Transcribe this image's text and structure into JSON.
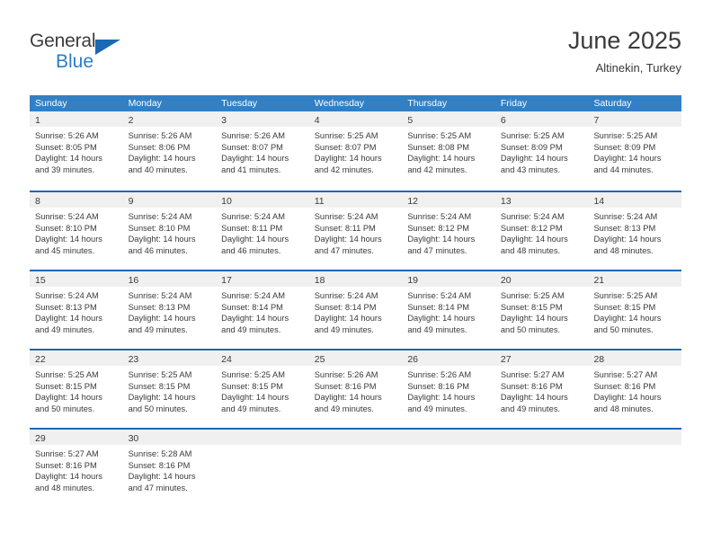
{
  "logo": {
    "word_one": "General",
    "word_two": "Blue",
    "triangle_color": "#1b68b3",
    "blue_text_color": "#2a7ec8"
  },
  "header": {
    "title": "June 2025",
    "location": "Altinekin, Turkey"
  },
  "theme": {
    "header_bar_color": "#3280c3",
    "row_divider_color": "#1b68b3",
    "daynum_strip_color": "#f0f0f0",
    "text_color": "#3a3a3a"
  },
  "weekdays": [
    "Sunday",
    "Monday",
    "Tuesday",
    "Wednesday",
    "Thursday",
    "Friday",
    "Saturday"
  ],
  "weeks": [
    [
      {
        "day": "1",
        "sunrise": "Sunrise: 5:26 AM",
        "sunset": "Sunset: 8:05 PM",
        "daylight": "Daylight: 14 hours and 39 minutes."
      },
      {
        "day": "2",
        "sunrise": "Sunrise: 5:26 AM",
        "sunset": "Sunset: 8:06 PM",
        "daylight": "Daylight: 14 hours and 40 minutes."
      },
      {
        "day": "3",
        "sunrise": "Sunrise: 5:26 AM",
        "sunset": "Sunset: 8:07 PM",
        "daylight": "Daylight: 14 hours and 41 minutes."
      },
      {
        "day": "4",
        "sunrise": "Sunrise: 5:25 AM",
        "sunset": "Sunset: 8:07 PM",
        "daylight": "Daylight: 14 hours and 42 minutes."
      },
      {
        "day": "5",
        "sunrise": "Sunrise: 5:25 AM",
        "sunset": "Sunset: 8:08 PM",
        "daylight": "Daylight: 14 hours and 42 minutes."
      },
      {
        "day": "6",
        "sunrise": "Sunrise: 5:25 AM",
        "sunset": "Sunset: 8:09 PM",
        "daylight": "Daylight: 14 hours and 43 minutes."
      },
      {
        "day": "7",
        "sunrise": "Sunrise: 5:25 AM",
        "sunset": "Sunset: 8:09 PM",
        "daylight": "Daylight: 14 hours and 44 minutes."
      }
    ],
    [
      {
        "day": "8",
        "sunrise": "Sunrise: 5:24 AM",
        "sunset": "Sunset: 8:10 PM",
        "daylight": "Daylight: 14 hours and 45 minutes."
      },
      {
        "day": "9",
        "sunrise": "Sunrise: 5:24 AM",
        "sunset": "Sunset: 8:10 PM",
        "daylight": "Daylight: 14 hours and 46 minutes."
      },
      {
        "day": "10",
        "sunrise": "Sunrise: 5:24 AM",
        "sunset": "Sunset: 8:11 PM",
        "daylight": "Daylight: 14 hours and 46 minutes."
      },
      {
        "day": "11",
        "sunrise": "Sunrise: 5:24 AM",
        "sunset": "Sunset: 8:11 PM",
        "daylight": "Daylight: 14 hours and 47 minutes."
      },
      {
        "day": "12",
        "sunrise": "Sunrise: 5:24 AM",
        "sunset": "Sunset: 8:12 PM",
        "daylight": "Daylight: 14 hours and 47 minutes."
      },
      {
        "day": "13",
        "sunrise": "Sunrise: 5:24 AM",
        "sunset": "Sunset: 8:12 PM",
        "daylight": "Daylight: 14 hours and 48 minutes."
      },
      {
        "day": "14",
        "sunrise": "Sunrise: 5:24 AM",
        "sunset": "Sunset: 8:13 PM",
        "daylight": "Daylight: 14 hours and 48 minutes."
      }
    ],
    [
      {
        "day": "15",
        "sunrise": "Sunrise: 5:24 AM",
        "sunset": "Sunset: 8:13 PM",
        "daylight": "Daylight: 14 hours and 49 minutes."
      },
      {
        "day": "16",
        "sunrise": "Sunrise: 5:24 AM",
        "sunset": "Sunset: 8:13 PM",
        "daylight": "Daylight: 14 hours and 49 minutes."
      },
      {
        "day": "17",
        "sunrise": "Sunrise: 5:24 AM",
        "sunset": "Sunset: 8:14 PM",
        "daylight": "Daylight: 14 hours and 49 minutes."
      },
      {
        "day": "18",
        "sunrise": "Sunrise: 5:24 AM",
        "sunset": "Sunset: 8:14 PM",
        "daylight": "Daylight: 14 hours and 49 minutes."
      },
      {
        "day": "19",
        "sunrise": "Sunrise: 5:24 AM",
        "sunset": "Sunset: 8:14 PM",
        "daylight": "Daylight: 14 hours and 49 minutes."
      },
      {
        "day": "20",
        "sunrise": "Sunrise: 5:25 AM",
        "sunset": "Sunset: 8:15 PM",
        "daylight": "Daylight: 14 hours and 50 minutes."
      },
      {
        "day": "21",
        "sunrise": "Sunrise: 5:25 AM",
        "sunset": "Sunset: 8:15 PM",
        "daylight": "Daylight: 14 hours and 50 minutes."
      }
    ],
    [
      {
        "day": "22",
        "sunrise": "Sunrise: 5:25 AM",
        "sunset": "Sunset: 8:15 PM",
        "daylight": "Daylight: 14 hours and 50 minutes."
      },
      {
        "day": "23",
        "sunrise": "Sunrise: 5:25 AM",
        "sunset": "Sunset: 8:15 PM",
        "daylight": "Daylight: 14 hours and 50 minutes."
      },
      {
        "day": "24",
        "sunrise": "Sunrise: 5:25 AM",
        "sunset": "Sunset: 8:15 PM",
        "daylight": "Daylight: 14 hours and 49 minutes."
      },
      {
        "day": "25",
        "sunrise": "Sunrise: 5:26 AM",
        "sunset": "Sunset: 8:16 PM",
        "daylight": "Daylight: 14 hours and 49 minutes."
      },
      {
        "day": "26",
        "sunrise": "Sunrise: 5:26 AM",
        "sunset": "Sunset: 8:16 PM",
        "daylight": "Daylight: 14 hours and 49 minutes."
      },
      {
        "day": "27",
        "sunrise": "Sunrise: 5:27 AM",
        "sunset": "Sunset: 8:16 PM",
        "daylight": "Daylight: 14 hours and 49 minutes."
      },
      {
        "day": "28",
        "sunrise": "Sunrise: 5:27 AM",
        "sunset": "Sunset: 8:16 PM",
        "daylight": "Daylight: 14 hours and 48 minutes."
      }
    ],
    [
      {
        "day": "29",
        "sunrise": "Sunrise: 5:27 AM",
        "sunset": "Sunset: 8:16 PM",
        "daylight": "Daylight: 14 hours and 48 minutes."
      },
      {
        "day": "30",
        "sunrise": "Sunrise: 5:28 AM",
        "sunset": "Sunset: 8:16 PM",
        "daylight": "Daylight: 14 hours and 47 minutes."
      },
      {
        "day": "",
        "sunrise": "",
        "sunset": "",
        "daylight": ""
      },
      {
        "day": "",
        "sunrise": "",
        "sunset": "",
        "daylight": ""
      },
      {
        "day": "",
        "sunrise": "",
        "sunset": "",
        "daylight": ""
      },
      {
        "day": "",
        "sunrise": "",
        "sunset": "",
        "daylight": ""
      },
      {
        "day": "",
        "sunrise": "",
        "sunset": "",
        "daylight": ""
      }
    ]
  ]
}
